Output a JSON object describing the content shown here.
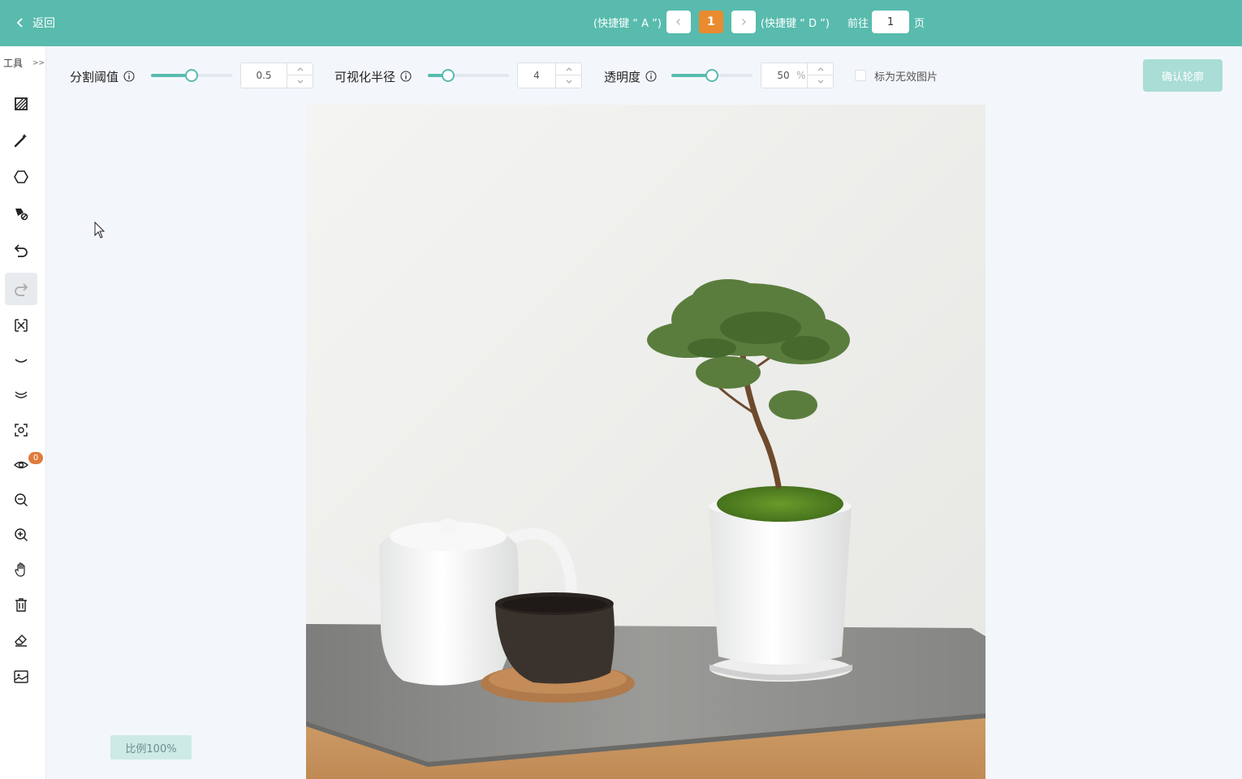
{
  "topbar": {
    "back_label": "返回",
    "prev_hint": "(快捷键 “ A ”)",
    "current_page": "1",
    "next_hint": "(快捷键 “ D ”)",
    "goto_label": "前往",
    "goto_value": "1",
    "page_unit": "页"
  },
  "sidebar": {
    "title": "工具",
    "expand": ">>",
    "tools": [
      "hatch-box-icon",
      "magic-wand-icon",
      "polygon-icon",
      "brush-erase-icon",
      "undo-icon",
      "redo-icon",
      "bbox-adjust-icon",
      "eye-closed-icon",
      "eye-lashes-icon",
      "focus-icon",
      "eye-icon",
      "zoom-out-icon",
      "zoom-in-icon",
      "hand-icon",
      "trash-icon",
      "eraser-icon",
      "image-icon"
    ],
    "visibility_badge": "0"
  },
  "controls": {
    "threshold": {
      "label": "分割阈值",
      "value": "0.5",
      "level": 0.5
    },
    "radius": {
      "label": "可视化半径",
      "value": "4",
      "level": 0.25
    },
    "opacity": {
      "label": "透明度",
      "value": "50",
      "unit": "%",
      "level": 0.5
    },
    "invalid_label": "标为无效图片",
    "confirm_label": "确认轮廓"
  },
  "zoom_label": "比例100%",
  "colors": {
    "accent": "#58bbad",
    "page_active": "#ea8b2f",
    "badge": "#e07b3d"
  }
}
